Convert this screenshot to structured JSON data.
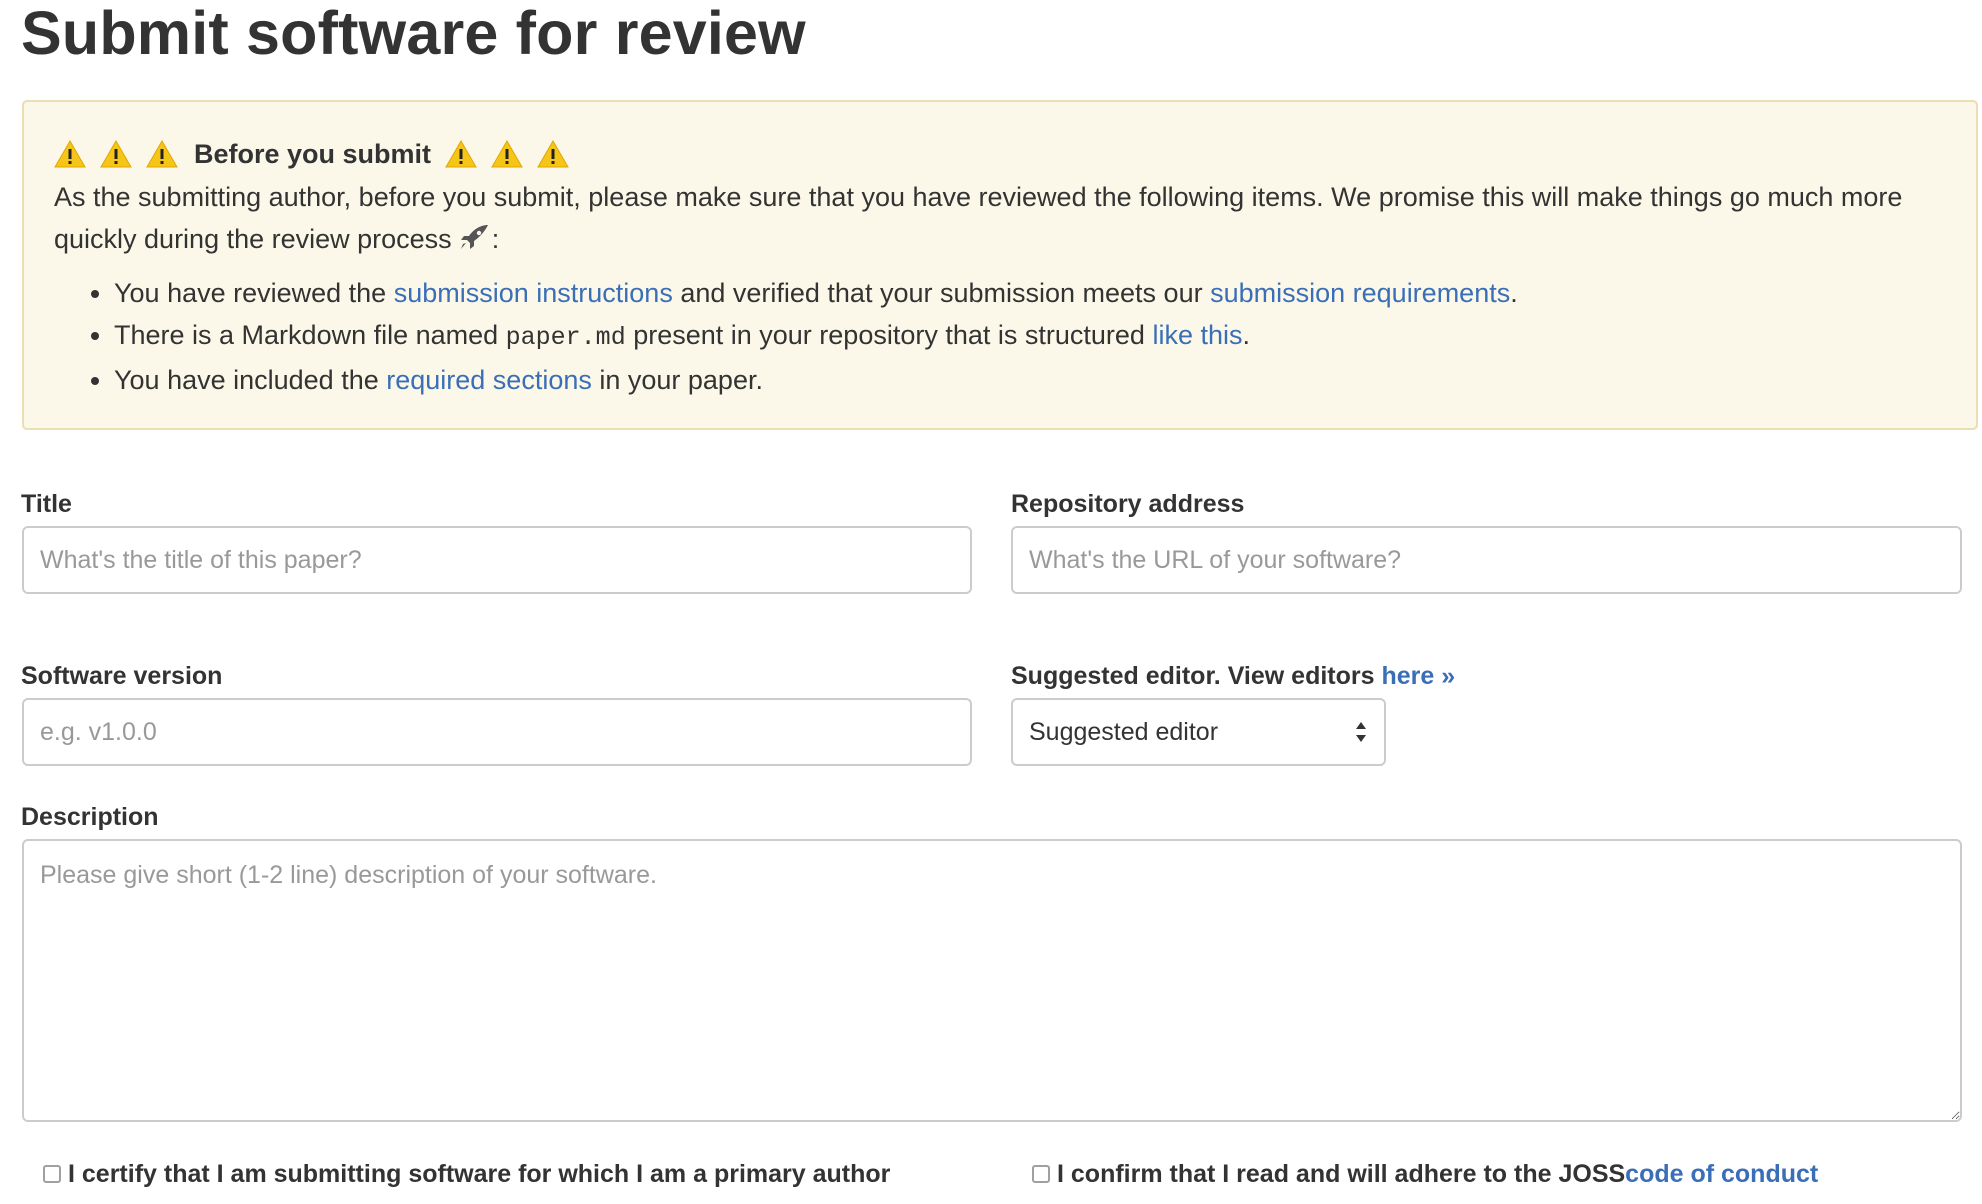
{
  "page": {
    "title": "Submit software for review"
  },
  "alert": {
    "heading": "Before you submit",
    "intro": "As the submitting author, before you submit, please make sure that you have reviewed the following items. We promise this will make things go much more quickly during the review process",
    "intro_suffix": ":",
    "icons": {
      "warning": "warning-icon",
      "rocket": "rocket-icon"
    },
    "items": [
      {
        "pre": "You have reviewed the ",
        "link1": "submission instructions",
        "mid": " and verified that your submission meets our ",
        "link2": "submission requirements",
        "post": "."
      },
      {
        "pre": "There is a Markdown file named ",
        "code": "paper.md",
        "mid": " present in your repository that is structured ",
        "link1": "like this",
        "post": "."
      },
      {
        "pre": "You have included the ",
        "link1": "required sections",
        "post": " in your paper."
      }
    ]
  },
  "form": {
    "title": {
      "label": "Title",
      "placeholder": "What's the title of this paper?"
    },
    "repository": {
      "label": "Repository address",
      "placeholder": "What's the URL of your software?"
    },
    "version": {
      "label": "Software version",
      "placeholder": "e.g. v1.0.0"
    },
    "editor": {
      "label": "Suggested editor. View editors ",
      "link": "here »",
      "selected": "Suggested editor"
    },
    "description": {
      "label": "Description",
      "placeholder": "Please give short (1-2 line) description of your software."
    },
    "certify": {
      "label": "I certify that I am submitting software for which I am a primary author"
    },
    "conduct": {
      "label": "I confirm that I read and will adhere to the JOSS ",
      "link": "code of conduct"
    }
  },
  "colors": {
    "link": "#3a6fb7",
    "alert_bg": "#fcf8e9",
    "alert_border": "#e9dfb4",
    "warning": "#f5c518",
    "text": "#333333"
  }
}
